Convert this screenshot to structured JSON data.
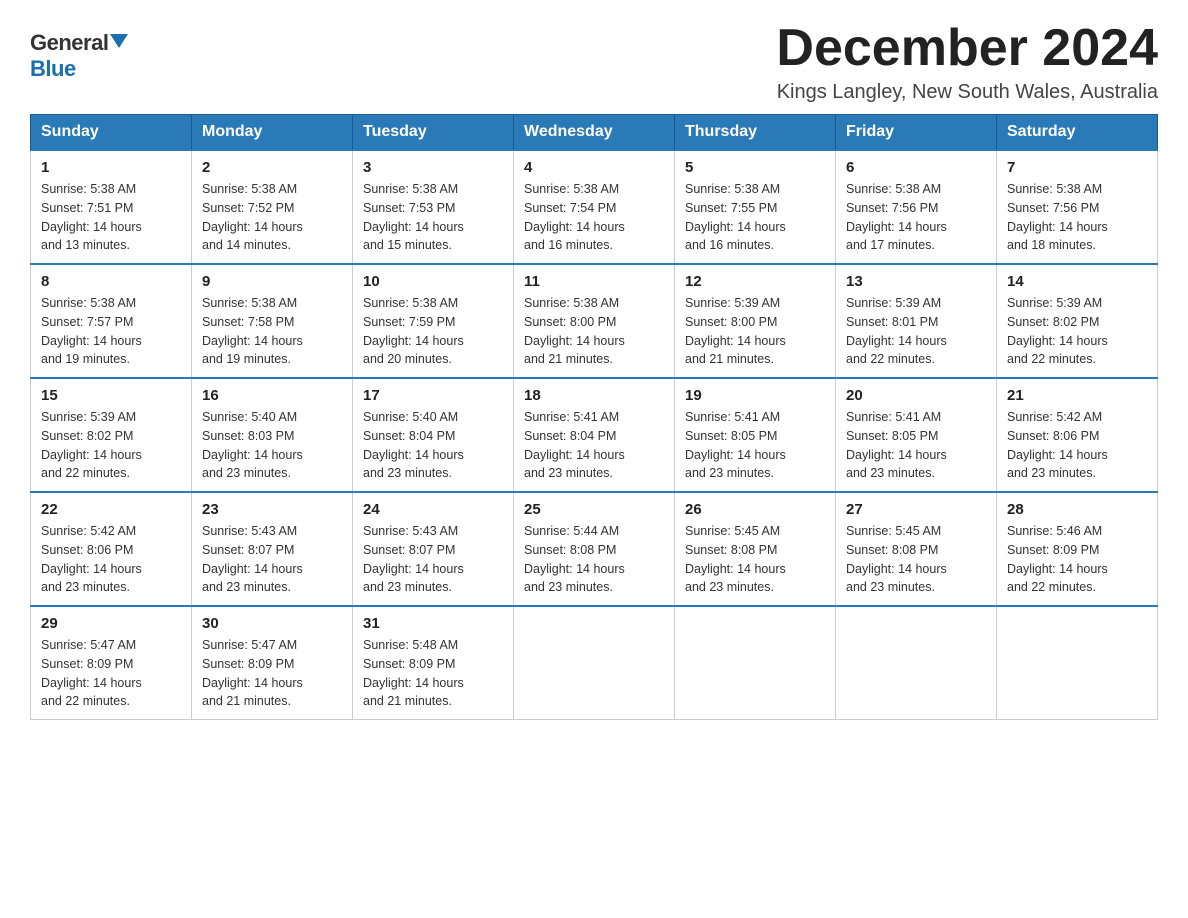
{
  "logo": {
    "general": "General",
    "blue": "Blue"
  },
  "header": {
    "month": "December 2024",
    "location": "Kings Langley, New South Wales, Australia"
  },
  "days_of_week": [
    "Sunday",
    "Monday",
    "Tuesday",
    "Wednesday",
    "Thursday",
    "Friday",
    "Saturday"
  ],
  "weeks": [
    [
      {
        "day": "1",
        "sunrise": "5:38 AM",
        "sunset": "7:51 PM",
        "daylight": "14 hours and 13 minutes."
      },
      {
        "day": "2",
        "sunrise": "5:38 AM",
        "sunset": "7:52 PM",
        "daylight": "14 hours and 14 minutes."
      },
      {
        "day": "3",
        "sunrise": "5:38 AM",
        "sunset": "7:53 PM",
        "daylight": "14 hours and 15 minutes."
      },
      {
        "day": "4",
        "sunrise": "5:38 AM",
        "sunset": "7:54 PM",
        "daylight": "14 hours and 16 minutes."
      },
      {
        "day": "5",
        "sunrise": "5:38 AM",
        "sunset": "7:55 PM",
        "daylight": "14 hours and 16 minutes."
      },
      {
        "day": "6",
        "sunrise": "5:38 AM",
        "sunset": "7:56 PM",
        "daylight": "14 hours and 17 minutes."
      },
      {
        "day": "7",
        "sunrise": "5:38 AM",
        "sunset": "7:56 PM",
        "daylight": "14 hours and 18 minutes."
      }
    ],
    [
      {
        "day": "8",
        "sunrise": "5:38 AM",
        "sunset": "7:57 PM",
        "daylight": "14 hours and 19 minutes."
      },
      {
        "day": "9",
        "sunrise": "5:38 AM",
        "sunset": "7:58 PM",
        "daylight": "14 hours and 19 minutes."
      },
      {
        "day": "10",
        "sunrise": "5:38 AM",
        "sunset": "7:59 PM",
        "daylight": "14 hours and 20 minutes."
      },
      {
        "day": "11",
        "sunrise": "5:38 AM",
        "sunset": "8:00 PM",
        "daylight": "14 hours and 21 minutes."
      },
      {
        "day": "12",
        "sunrise": "5:39 AM",
        "sunset": "8:00 PM",
        "daylight": "14 hours and 21 minutes."
      },
      {
        "day": "13",
        "sunrise": "5:39 AM",
        "sunset": "8:01 PM",
        "daylight": "14 hours and 22 minutes."
      },
      {
        "day": "14",
        "sunrise": "5:39 AM",
        "sunset": "8:02 PM",
        "daylight": "14 hours and 22 minutes."
      }
    ],
    [
      {
        "day": "15",
        "sunrise": "5:39 AM",
        "sunset": "8:02 PM",
        "daylight": "14 hours and 22 minutes."
      },
      {
        "day": "16",
        "sunrise": "5:40 AM",
        "sunset": "8:03 PM",
        "daylight": "14 hours and 23 minutes."
      },
      {
        "day": "17",
        "sunrise": "5:40 AM",
        "sunset": "8:04 PM",
        "daylight": "14 hours and 23 minutes."
      },
      {
        "day": "18",
        "sunrise": "5:41 AM",
        "sunset": "8:04 PM",
        "daylight": "14 hours and 23 minutes."
      },
      {
        "day": "19",
        "sunrise": "5:41 AM",
        "sunset": "8:05 PM",
        "daylight": "14 hours and 23 minutes."
      },
      {
        "day": "20",
        "sunrise": "5:41 AM",
        "sunset": "8:05 PM",
        "daylight": "14 hours and 23 minutes."
      },
      {
        "day": "21",
        "sunrise": "5:42 AM",
        "sunset": "8:06 PM",
        "daylight": "14 hours and 23 minutes."
      }
    ],
    [
      {
        "day": "22",
        "sunrise": "5:42 AM",
        "sunset": "8:06 PM",
        "daylight": "14 hours and 23 minutes."
      },
      {
        "day": "23",
        "sunrise": "5:43 AM",
        "sunset": "8:07 PM",
        "daylight": "14 hours and 23 minutes."
      },
      {
        "day": "24",
        "sunrise": "5:43 AM",
        "sunset": "8:07 PM",
        "daylight": "14 hours and 23 minutes."
      },
      {
        "day": "25",
        "sunrise": "5:44 AM",
        "sunset": "8:08 PM",
        "daylight": "14 hours and 23 minutes."
      },
      {
        "day": "26",
        "sunrise": "5:45 AM",
        "sunset": "8:08 PM",
        "daylight": "14 hours and 23 minutes."
      },
      {
        "day": "27",
        "sunrise": "5:45 AM",
        "sunset": "8:08 PM",
        "daylight": "14 hours and 23 minutes."
      },
      {
        "day": "28",
        "sunrise": "5:46 AM",
        "sunset": "8:09 PM",
        "daylight": "14 hours and 22 minutes."
      }
    ],
    [
      {
        "day": "29",
        "sunrise": "5:47 AM",
        "sunset": "8:09 PM",
        "daylight": "14 hours and 22 minutes."
      },
      {
        "day": "30",
        "sunrise": "5:47 AM",
        "sunset": "8:09 PM",
        "daylight": "14 hours and 21 minutes."
      },
      {
        "day": "31",
        "sunrise": "5:48 AM",
        "sunset": "8:09 PM",
        "daylight": "14 hours and 21 minutes."
      },
      null,
      null,
      null,
      null
    ]
  ],
  "labels": {
    "sunrise": "Sunrise:",
    "sunset": "Sunset:",
    "daylight": "Daylight:"
  }
}
